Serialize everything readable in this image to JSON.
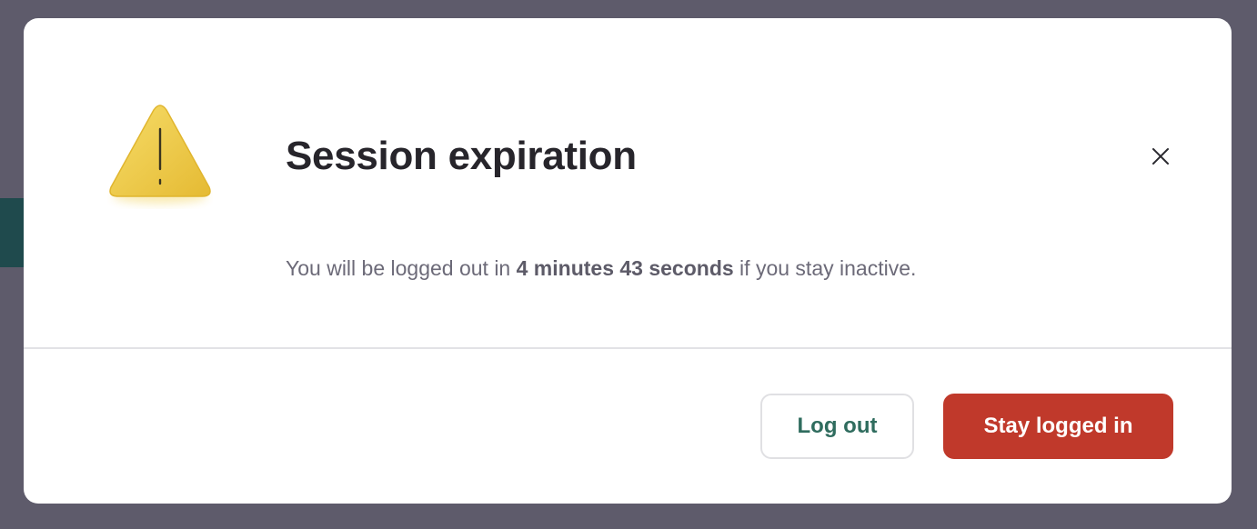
{
  "dialog": {
    "title": "Session expiration",
    "message": {
      "before": "You will be logged out in ",
      "time": "4 minutes 43 seconds",
      "after": " if you stay inactive."
    },
    "icons": {
      "warning": "warning-triangle-icon",
      "close": "close-icon"
    }
  },
  "actions": {
    "logout_label": "Log out",
    "stay_label": "Stay logged in"
  },
  "colors": {
    "overlay": "#5e5b6b",
    "warning_fill": "#f0cc45",
    "primary_button": "#c0392b",
    "secondary_text": "#2f6c5e",
    "title_text": "#27252b",
    "body_text": "#6c6a78"
  }
}
